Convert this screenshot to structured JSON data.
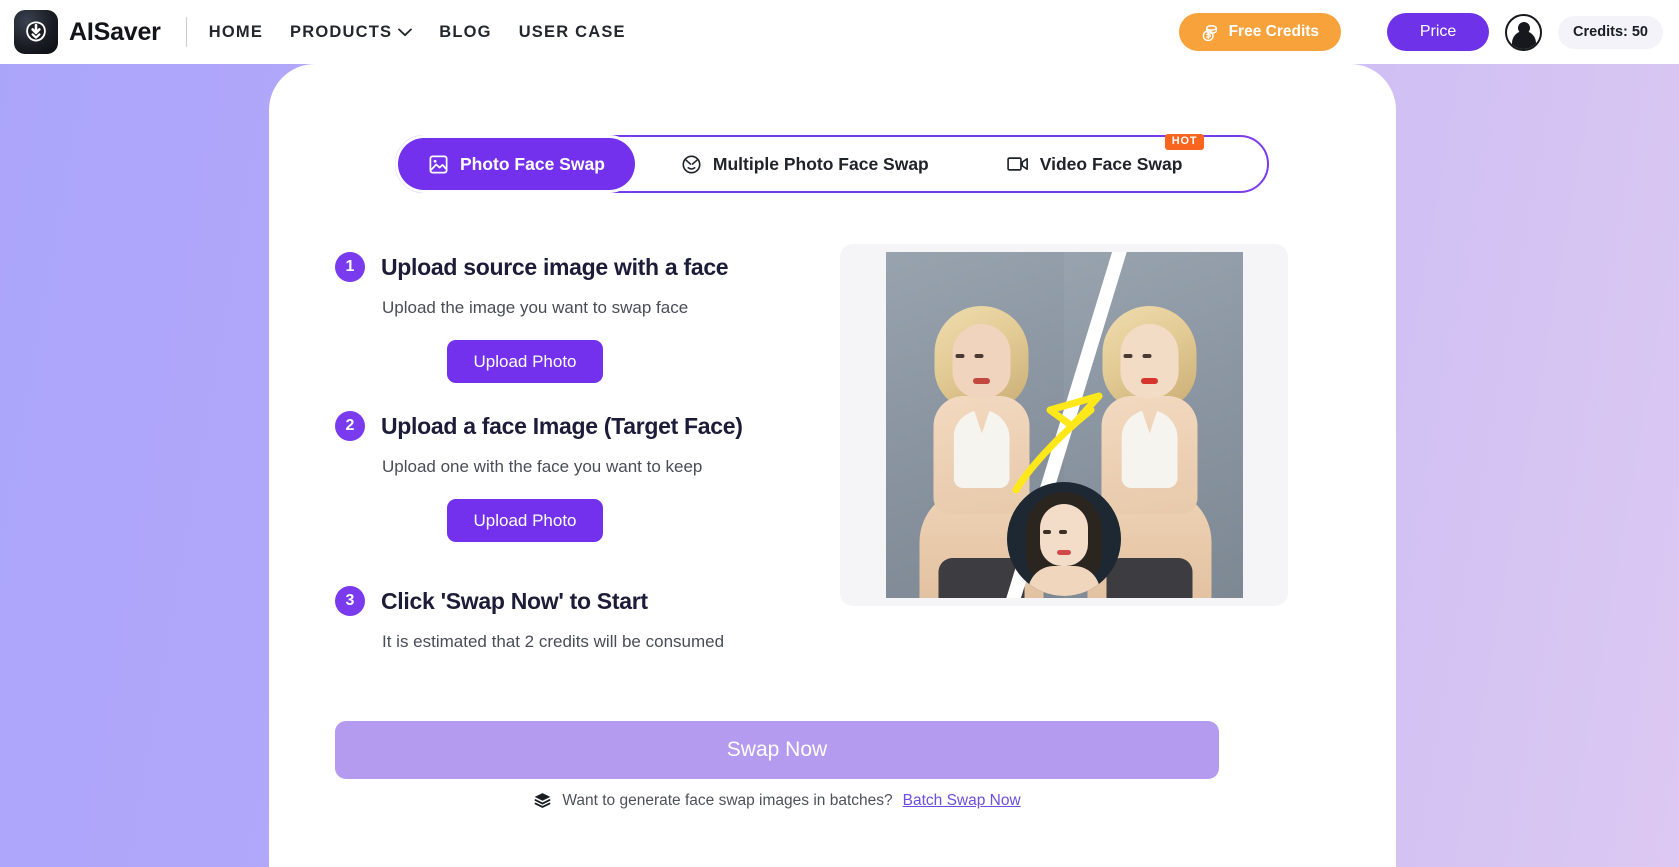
{
  "header": {
    "brand_name": "AISaver",
    "logo_icon": "download-arrow-icon",
    "nav": [
      {
        "label": "HOME",
        "icon": null
      },
      {
        "label": "PRODUCTS",
        "icon": "chevron-down-icon"
      },
      {
        "label": "BLOG",
        "icon": null
      },
      {
        "label": "USER CASE",
        "icon": null
      }
    ],
    "free_credits_label": "Free Credits",
    "free_credits_icon": "coins-icon",
    "free_credits_color": "#F7A23B",
    "price_label": "Price",
    "price_color": "#6E33E8",
    "avatar_icon": "user-avatar-icon",
    "credits_label": "Credits: 50"
  },
  "tabs": [
    {
      "label": "Photo Face Swap",
      "icon": "image-icon",
      "active": true,
      "badge": null
    },
    {
      "label": "Multiple Photo Face Swap",
      "icon": "faces-icon",
      "active": false,
      "badge": null
    },
    {
      "label": "Video Face Swap",
      "icon": "video-camera-icon",
      "active": false,
      "badge": "HOT"
    }
  ],
  "steps": [
    {
      "number": "1",
      "title": "Upload source image with a face",
      "subtitle": "Upload the image you want to swap face",
      "button_label": "Upload Photo"
    },
    {
      "number": "2",
      "title": "Upload a face Image (Target Face)",
      "subtitle": "Upload one with the face you want to keep",
      "button_label": "Upload Photo"
    },
    {
      "number": "3",
      "title": "Click 'Swap Now' to Start",
      "subtitle": "It is estimated that 2 credits will be consumed",
      "button_label": null
    }
  ],
  "preview": {
    "alt": "before-after-face-swap-example",
    "inset_alt": "target-face-thumbnail",
    "arrow_color": "#FFE81A"
  },
  "action": {
    "swap_label": "Swap Now",
    "swap_color": "#B49BF0",
    "batch_icon": "layers-icon",
    "batch_text": "Want to generate face swap images in batches?",
    "batch_link_label": "Batch Swap Now",
    "batch_link_color": "#6C4FE0"
  },
  "theme": {
    "accent": "#7331EE",
    "accent_border": "#7A3BEF",
    "badge": "#F9641E",
    "bg_left": "#ABA5FA",
    "bg_right": "#DCC8F2"
  }
}
